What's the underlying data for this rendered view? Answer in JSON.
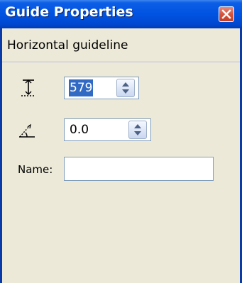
{
  "window": {
    "title": "Guide Properties"
  },
  "section": {
    "heading": "Horizontal guideline"
  },
  "position": {
    "icon": "guide-position-icon",
    "value": "579"
  },
  "angle": {
    "icon": "angle-icon",
    "value": "0.0"
  },
  "name": {
    "label": "Name:",
    "value": ""
  },
  "colors": {
    "titlebar": "#0053e1",
    "window_bg": "#ece9d8",
    "close_button": "#d2523a",
    "selection": "#316ac5",
    "border": "#7f9db9"
  }
}
